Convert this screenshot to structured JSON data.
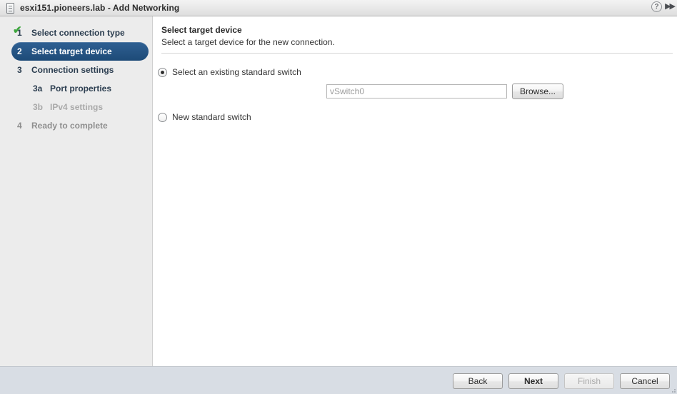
{
  "window": {
    "title": "esxi151.pioneers.lab - Add Networking",
    "icon": "host-icon",
    "help_icon": "?",
    "collapse_icon": "▶▶"
  },
  "sidebar": {
    "steps": [
      {
        "num": "1",
        "label": "Select connection type",
        "state": "completed",
        "check": "✔"
      },
      {
        "num": "2",
        "label": "Select target device",
        "state": "selected"
      },
      {
        "num": "3",
        "label": "Connection settings",
        "state": "normal"
      },
      {
        "num": "3a",
        "label": "Port properties",
        "state": "normal"
      },
      {
        "num": "3b",
        "label": "IPv4 settings",
        "state": "dim"
      },
      {
        "num": "4",
        "label": "Ready to complete",
        "state": "muted"
      }
    ]
  },
  "main": {
    "title": "Select target device",
    "subtitle": "Select a target device for the new connection.",
    "options": [
      {
        "label": "Select an existing standard switch",
        "selected": true
      },
      {
        "label": "New standard switch",
        "selected": false
      }
    ],
    "switch_field": {
      "value": "",
      "placeholder": "vSwitch0"
    },
    "browse_label": "Browse..."
  },
  "footer": {
    "back_label": "Back",
    "next_label": "Next",
    "finish_label": "Finish",
    "cancel_label": "Cancel"
  },
  "colors": {
    "selected_step": "#1d4a77",
    "check_green": "#3da63d",
    "footer_bg": "#d8dde4",
    "sidebar_bg": "#ececec"
  }
}
